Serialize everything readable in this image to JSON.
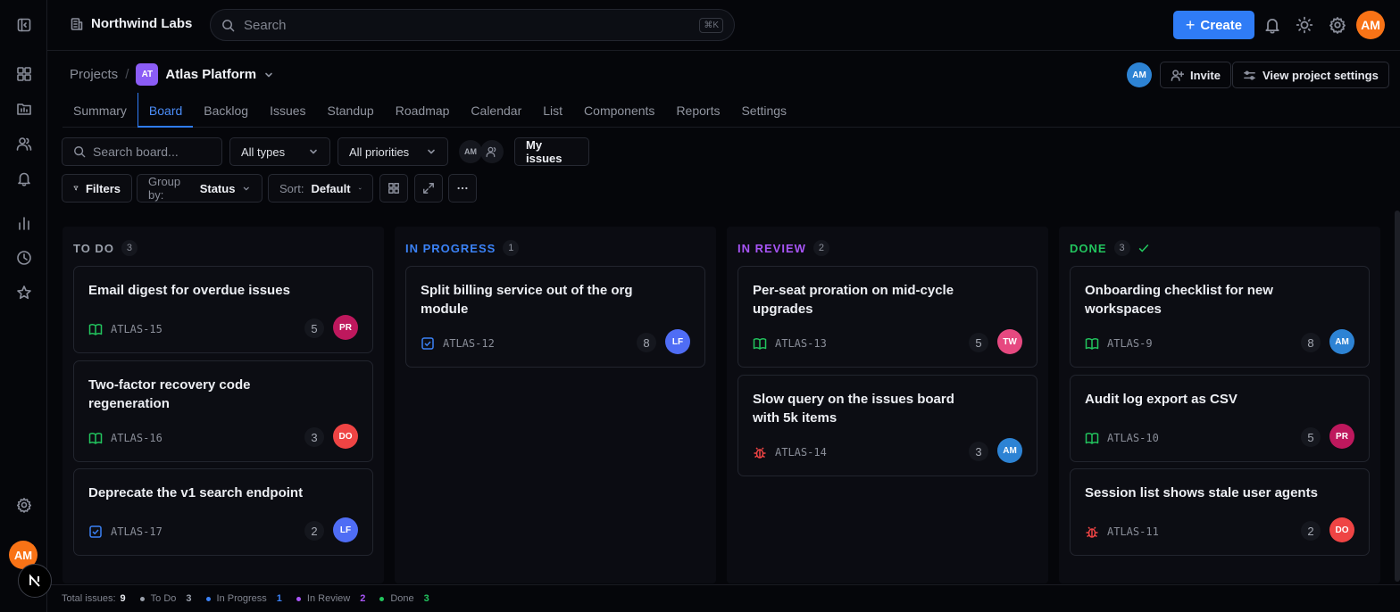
{
  "workspace": {
    "name": "Northwind Labs"
  },
  "search": {
    "placeholder": "Search",
    "shortcut": "⌘K"
  },
  "topbar": {
    "create_label": "Create",
    "user_initials": "AM"
  },
  "breadcrumb": {
    "root": "Projects",
    "separator": "/",
    "project_badge": "AT",
    "project_name": "Atlas Platform"
  },
  "header": {
    "member_initials": "AM",
    "invite_label": "Invite",
    "settings_label": "View project settings"
  },
  "tabs": [
    {
      "label": "Summary"
    },
    {
      "label": "Board"
    },
    {
      "label": "Backlog"
    },
    {
      "label": "Issues"
    },
    {
      "label": "Standup"
    },
    {
      "label": "Roadmap"
    },
    {
      "label": "Calendar"
    },
    {
      "label": "List"
    },
    {
      "label": "Components"
    },
    {
      "label": "Reports"
    },
    {
      "label": "Settings"
    }
  ],
  "active_tab": "Board",
  "toolbar": {
    "search_placeholder": "Search board...",
    "type_filter": "All types",
    "priority_filter": "All priorities",
    "assignee_initials": "AM",
    "my_issues": "My issues",
    "filters": "Filters",
    "group_by_label": "Group by:",
    "group_by_value": "Status",
    "sort_label": "Sort:",
    "sort_value": "Default"
  },
  "columns": [
    {
      "title": "TO DO",
      "count": "3",
      "color": "#9aa0ab",
      "cards": [
        {
          "title": "Email digest for overdue issues",
          "key": "ATLAS-15",
          "type": "story",
          "points": "5",
          "assignee": "PR",
          "avatar_color": "#be185d"
        },
        {
          "title": "Two-factor recovery code regeneration",
          "key": "ATLAS-16",
          "type": "story",
          "points": "3",
          "assignee": "DO",
          "avatar_color": "#ef4444"
        },
        {
          "title": "Deprecate the v1 search endpoint",
          "key": "ATLAS-17",
          "type": "task",
          "points": "2",
          "assignee": "LF",
          "avatar_color": "#4f6df5"
        }
      ]
    },
    {
      "title": "IN PROGRESS",
      "count": "1",
      "color": "#3b82f6",
      "cards": [
        {
          "title": "Split billing service out of the org module",
          "key": "ATLAS-12",
          "type": "task",
          "points": "8",
          "assignee": "LF",
          "avatar_color": "#4f6df5"
        }
      ]
    },
    {
      "title": "IN REVIEW",
      "count": "2",
      "color": "#a855f7",
      "cards": [
        {
          "title": "Per-seat proration on mid-cycle upgrades",
          "key": "ATLAS-13",
          "type": "story",
          "points": "5",
          "assignee": "TW",
          "avatar_color": "#e64980"
        },
        {
          "title": "Slow query on the issues board with 5k items",
          "key": "ATLAS-14",
          "type": "bug",
          "points": "3",
          "assignee": "AM",
          "avatar_color": "#2d83d4"
        }
      ]
    },
    {
      "title": "DONE",
      "count": "3",
      "color": "#22c55e",
      "cards": [
        {
          "title": "Onboarding checklist for new workspaces",
          "key": "ATLAS-9",
          "type": "story",
          "points": "8",
          "assignee": "AM",
          "avatar_color": "#2d83d4"
        },
        {
          "title": "Audit log export as CSV",
          "key": "ATLAS-10",
          "type": "story",
          "points": "5",
          "assignee": "PR",
          "avatar_color": "#be185d"
        },
        {
          "title": "Session list shows stale user agents",
          "key": "ATLAS-11",
          "type": "bug",
          "points": "2",
          "assignee": "DO",
          "avatar_color": "#ef4444"
        }
      ]
    }
  ],
  "statusbar": {
    "total_label": "Total issues:",
    "total": "9",
    "items": [
      {
        "label": "To Do",
        "value": "3",
        "color": "#9aa0ab"
      },
      {
        "label": "In Progress",
        "value": "1",
        "color": "#3b82f6"
      },
      {
        "label": "In Review",
        "value": "2",
        "color": "#a855f7"
      },
      {
        "label": "Done",
        "value": "3",
        "color": "#22c55e"
      }
    ]
  },
  "colors": {
    "accent": "#2f7cf6",
    "story": "#22c55e",
    "task": "#3b82f6",
    "bug": "#ef4444"
  }
}
